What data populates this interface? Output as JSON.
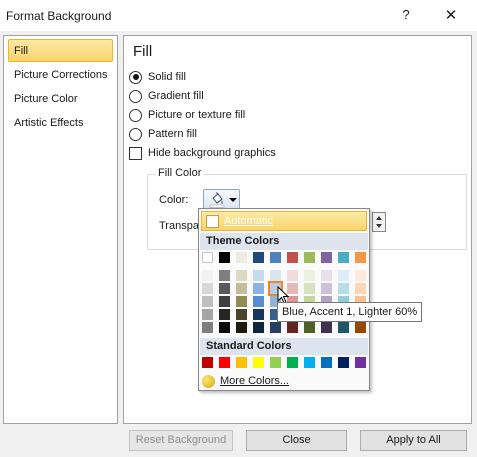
{
  "window": {
    "title": "Format Background",
    "help": "?",
    "close": "✕"
  },
  "sidebar": {
    "items": [
      {
        "label": "Fill",
        "active": true
      },
      {
        "label": "Picture Corrections",
        "active": false
      },
      {
        "label": "Picture Color",
        "active": false
      },
      {
        "label": "Artistic Effects",
        "active": false
      }
    ]
  },
  "fill": {
    "title": "Fill",
    "options": [
      {
        "label": "Solid fill",
        "checked": true
      },
      {
        "label": "Gradient fill",
        "checked": false
      },
      {
        "label": "Picture or texture fill",
        "checked": false
      },
      {
        "label": "Pattern fill",
        "checked": false
      }
    ],
    "hide_bg_label": "Hide background graphics",
    "hide_bg_checked": false,
    "group_label": "Fill Color",
    "color_label": "Color:",
    "transparency_label": "Transpa"
  },
  "popup": {
    "automatic_label": "Automatic",
    "theme_header": "Theme Colors",
    "standard_header": "Standard Colors",
    "more_colors_label": "More Colors...",
    "theme_top_row": [
      "#ffffff",
      "#000000",
      "#eeece1",
      "#1f497d",
      "#4f81bd",
      "#c0504d",
      "#9bbb59",
      "#8064a2",
      "#4bacc6",
      "#f79646"
    ],
    "theme_shades": [
      [
        "#f2f2f2",
        "#7f7f7f",
        "#ddd9c3",
        "#c6d9f0",
        "#dbe5f1",
        "#f2dcdb",
        "#ebf1dd",
        "#e5e0ec",
        "#dbeef3",
        "#fdeada"
      ],
      [
        "#d8d8d8",
        "#595959",
        "#c4bd97",
        "#8db3e2",
        "#b8cce4",
        "#e5b9b7",
        "#d7e3bc",
        "#ccc1d9",
        "#b7dde8",
        "#fbd5b5"
      ],
      [
        "#bfbfbf",
        "#3f3f3f",
        "#938953",
        "#548dd4",
        "#95b3d7",
        "#d99694",
        "#c3d69b",
        "#b2a2c7",
        "#92cddc",
        "#fac08f"
      ],
      [
        "#a5a5a5",
        "#262626",
        "#494429",
        "#17365d",
        "#366092",
        "#953734",
        "#76923c",
        "#5f497a",
        "#31859b",
        "#e36c09"
      ],
      [
        "#7f7f7f",
        "#0c0c0c",
        "#1d1b10",
        "#0f243e",
        "#244061",
        "#632423",
        "#4f6128",
        "#3f3151",
        "#205867",
        "#974806"
      ]
    ],
    "standard_colors": [
      "#c00000",
      "#ff0000",
      "#ffc000",
      "#ffff00",
      "#92d050",
      "#00b050",
      "#00b0f0",
      "#0070c0",
      "#002060",
      "#7030a0"
    ],
    "hover_swatch": "Blue, Accent 1, Lighter 60%"
  },
  "tooltip": "Blue, Accent 1, Lighter 60%",
  "footer": {
    "reset_label": "Reset Background",
    "close_label": "Close",
    "apply_label": "Apply to All"
  }
}
